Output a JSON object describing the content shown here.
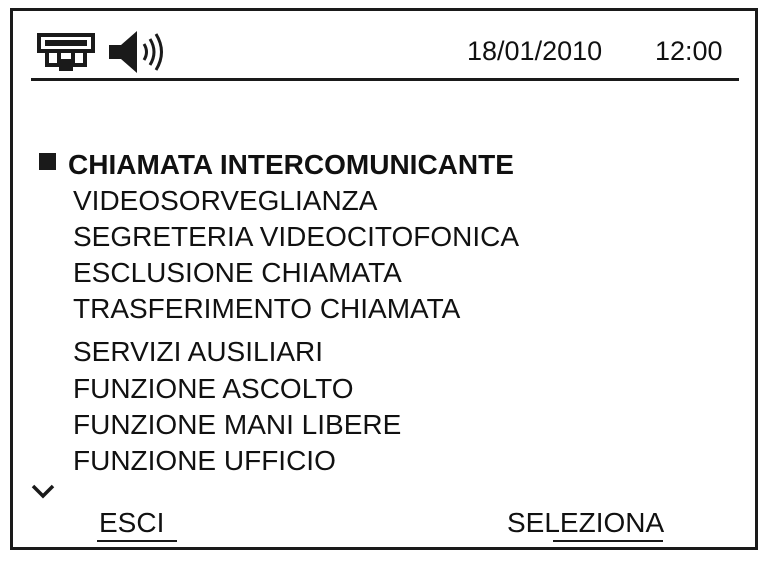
{
  "status_bar": {
    "intercom_icon": "intercom-network-icon",
    "speaker_icon": "speaker-volume-icon",
    "date": "18/01/2010",
    "time": "12:00"
  },
  "menu": {
    "selected_index": 0,
    "items": [
      {
        "label": "CHIAMATA INTERCOMUNICANTE"
      },
      {
        "label": "VIDEOSORVEGLIANZA"
      },
      {
        "label": "SEGRETERIA VIDEOCITOFONICA"
      },
      {
        "label": "ESCLUSIONE CHIAMATA"
      },
      {
        "label": "TRASFERIMENTO CHIAMATA"
      },
      {
        "label": "SERVIZI AUSILIARI"
      },
      {
        "label": "FUNZIONE ASCOLTO"
      },
      {
        "label": "FUNZIONE MANI LIBERE"
      },
      {
        "label": "FUNZIONE UFFICIO"
      }
    ],
    "more_indicator": "chevron-down-icon"
  },
  "softkeys": {
    "left_label": "ESCI",
    "right_label": "SELEZIONA"
  }
}
